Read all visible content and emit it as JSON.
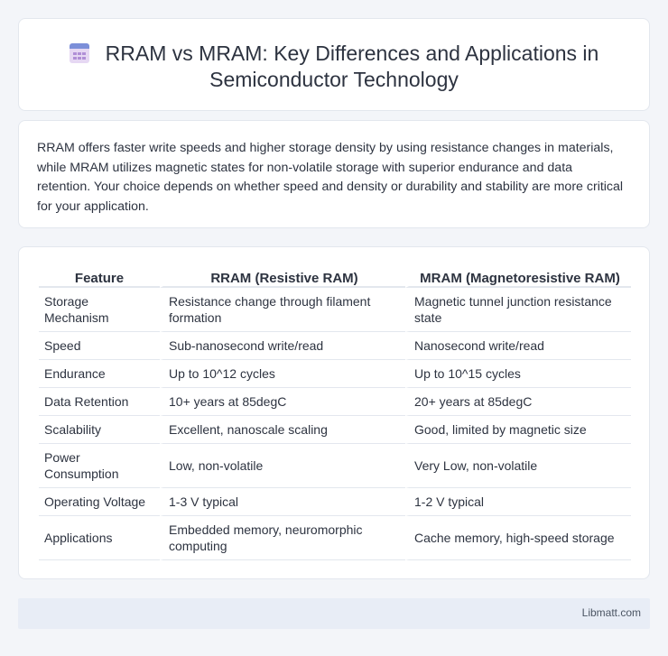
{
  "header": {
    "title": "RRAM vs MRAM: Key Differences and Applications in Semiconductor Technology",
    "icon": "calendar-icon"
  },
  "summary": "RRAM offers faster write speeds and higher storage density by using resistance changes in materials, while MRAM utilizes magnetic states for non-volatile storage with superior endurance and data retention. Your choice depends on whether speed and density or durability and stability are more critical for your application.",
  "table": {
    "headers": [
      "Feature",
      "RRAM (Resistive RAM)",
      "MRAM (Magnetoresistive RAM)"
    ],
    "rows": [
      [
        "Storage Mechanism",
        "Resistance change through filament formation",
        "Magnetic tunnel junction resistance state"
      ],
      [
        "Speed",
        "Sub-nanosecond write/read",
        "Nanosecond write/read"
      ],
      [
        "Endurance",
        "Up to 10^12 cycles",
        "Up to 10^15 cycles"
      ],
      [
        "Data Retention",
        "10+ years at 85degC",
        "20+ years at 85degC"
      ],
      [
        "Scalability",
        "Excellent, nanoscale scaling",
        "Good, limited by magnetic size"
      ],
      [
        "Power Consumption",
        "Low, non-volatile",
        "Very Low, non-volatile"
      ],
      [
        "Operating Voltage",
        "1-3 V typical",
        "1-2 V typical"
      ],
      [
        "Applications",
        "Embedded memory, neuromorphic computing",
        "Cache memory, high-speed storage"
      ]
    ]
  },
  "footer": {
    "brand": "Libmatt.com"
  }
}
